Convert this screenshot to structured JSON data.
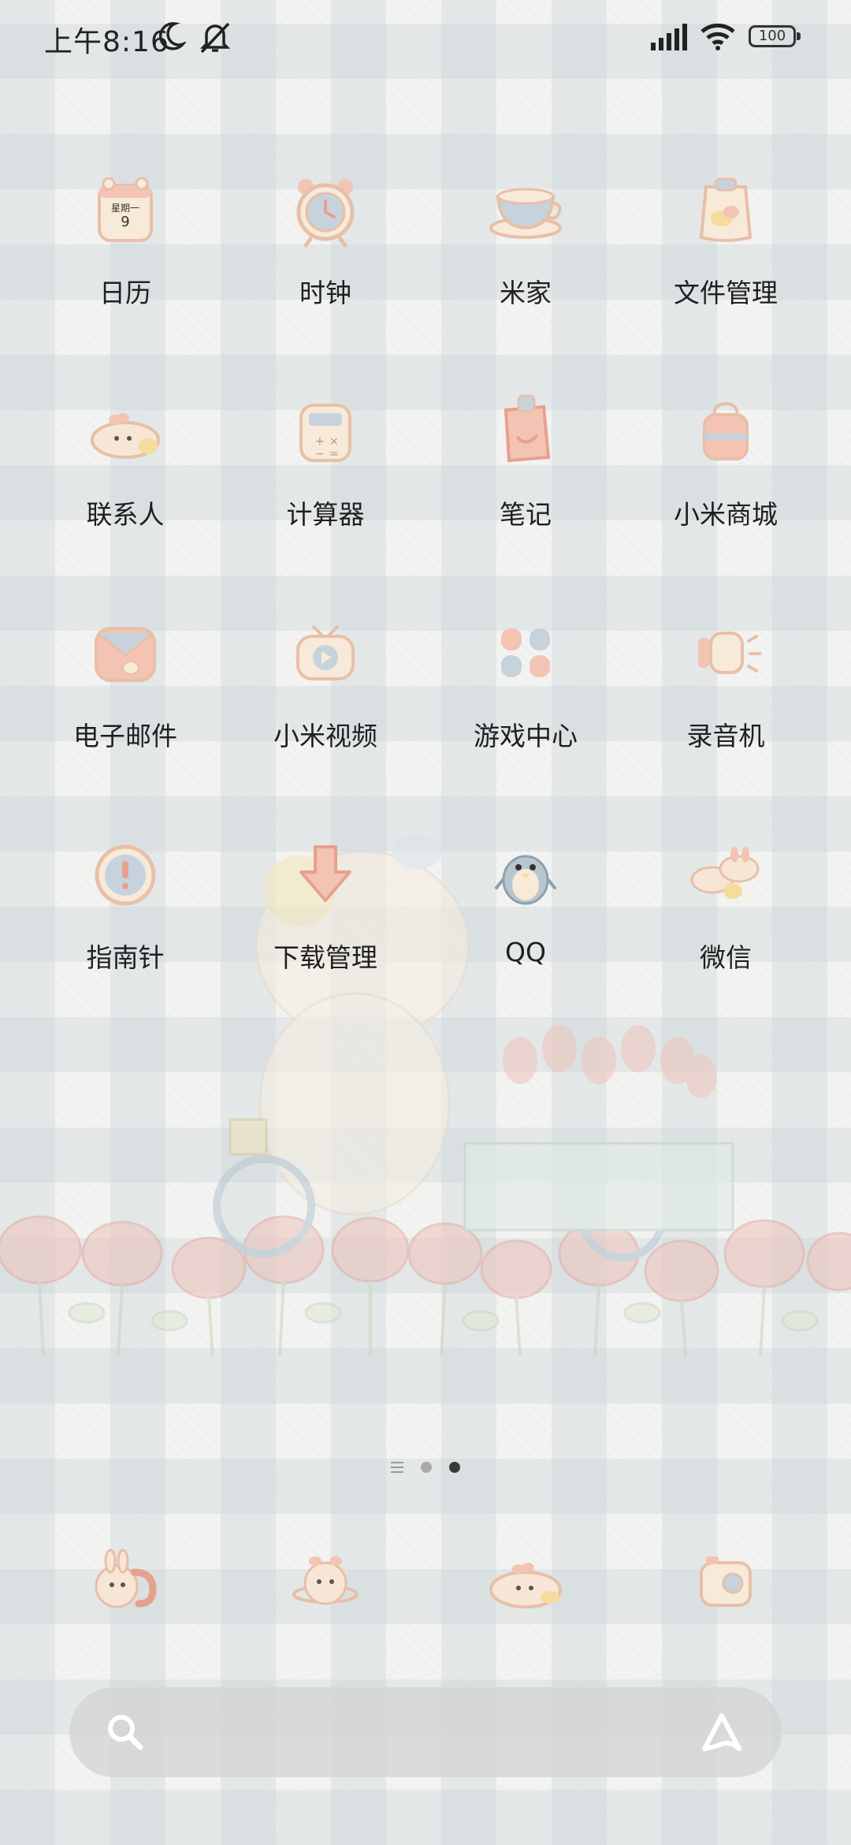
{
  "status_bar": {
    "time": "上午8:16",
    "icons": [
      "moon-icon",
      "bell-muted-icon",
      "signal-icon",
      "wifi-icon",
      "battery-icon"
    ],
    "battery_level": "100"
  },
  "apps": [
    {
      "label": "日历",
      "icon": "calendar-icon",
      "calendar_weekday": "星期一",
      "calendar_day": "9"
    },
    {
      "label": "时钟",
      "icon": "clock-icon"
    },
    {
      "label": "米家",
      "icon": "teacup-icon"
    },
    {
      "label": "文件管理",
      "icon": "file-bag-icon"
    },
    {
      "label": "联系人",
      "icon": "bunny-contacts-icon"
    },
    {
      "label": "计算器",
      "icon": "calculator-icon"
    },
    {
      "label": "笔记",
      "icon": "notes-icon"
    },
    {
      "label": "小米商城",
      "icon": "shopping-bag-icon"
    },
    {
      "label": "电子邮件",
      "icon": "envelope-icon"
    },
    {
      "label": "小米视频",
      "icon": "tv-play-icon"
    },
    {
      "label": "游戏中心",
      "icon": "game-pads-icon"
    },
    {
      "label": "录音机",
      "icon": "recorder-icon"
    },
    {
      "label": "指南针",
      "icon": "compass-icon"
    },
    {
      "label": "下载管理",
      "icon": "download-arrow-icon"
    },
    {
      "label": "QQ",
      "icon": "qq-penguin-icon"
    },
    {
      "label": "微信",
      "icon": "wechat-bunnies-icon"
    }
  ],
  "page_indicator": {
    "pages": 2,
    "active": 2
  },
  "dock": [
    {
      "icon": "bunny-phone-icon"
    },
    {
      "icon": "bunny-globe-icon"
    },
    {
      "icon": "bunny-messages-icon"
    },
    {
      "icon": "camera-icon"
    }
  ],
  "search": {
    "icon": "search-icon",
    "assistant_icon": "assistant-icon"
  },
  "colors": {
    "wallpaper": "#f1f2ef",
    "plaid": "#c8d2d7",
    "icon_cream": "#f7ead8",
    "icon_peach": "#f3c3b3",
    "icon_blue": "#c7d3dc",
    "text": "#1f1f1f"
  }
}
